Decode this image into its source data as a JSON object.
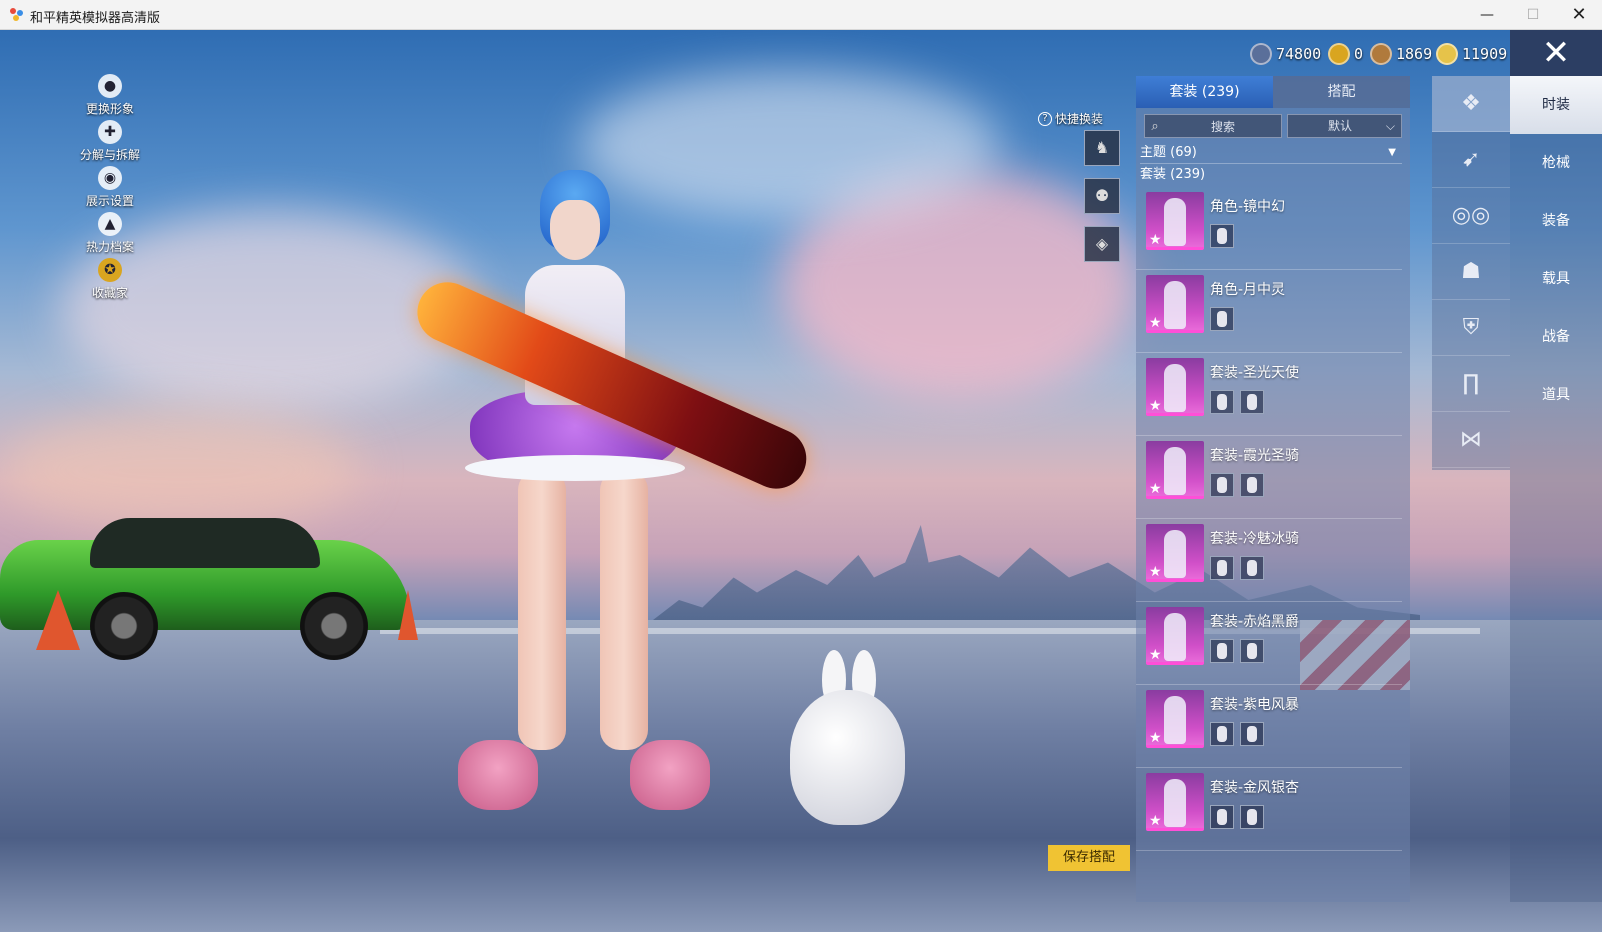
{
  "window": {
    "title": "和平精英模拟器高清版",
    "minimize": "—",
    "maximize": "☐",
    "close": "✕"
  },
  "left_menu": [
    {
      "label": "更换形象",
      "icon": "avatar-icon",
      "glyph": "●"
    },
    {
      "label": "分解与拆解",
      "icon": "puzzle-icon",
      "glyph": "✚"
    },
    {
      "label": "展示设置",
      "icon": "eye-icon",
      "glyph": "◉"
    },
    {
      "label": "热力档案",
      "icon": "flame-icon",
      "glyph": "▲"
    },
    {
      "label": "收藏家",
      "icon": "collector-badge-icon",
      "glyph": "✪"
    }
  ],
  "currency": [
    {
      "value": "74800",
      "color": "#5a6f9a",
      "icon": "silver-coin-icon"
    },
    {
      "value": "0",
      "color": "#d9a520",
      "icon": "gold-a-coin-icon"
    },
    {
      "value": "1869",
      "color": "#b07a3c",
      "icon": "bronze-coin-icon"
    },
    {
      "value": "11909",
      "color": "#e6c34a",
      "icon": "gold-coin-icon"
    }
  ],
  "close_button": "✕",
  "quick_switch": {
    "label": "快捷换装",
    "help": "?",
    "slots": [
      "♞",
      "⚉",
      "◈"
    ]
  },
  "save_button": "保存搭配",
  "panel": {
    "tabs": [
      "套装 (239)",
      "搭配"
    ],
    "search_placeholder": "搜索",
    "sort_label": "默认",
    "sort_chevron": "⌵",
    "search_glyph": "⌕",
    "theme_label": "主题 (69)",
    "theme_arrow": "▼",
    "set_count": "套装 (239)",
    "items": [
      {
        "name": "角色-镜中幻",
        "subs": 1
      },
      {
        "name": "角色-月中灵",
        "subs": 1
      },
      {
        "name": "套装-圣光天使",
        "subs": 2
      },
      {
        "name": "套装-霞光圣骑",
        "subs": 2
      },
      {
        "name": "套装-冷魅冰骑",
        "subs": 2
      },
      {
        "name": "套装-赤焰黑爵",
        "subs": 2
      },
      {
        "name": "套装-紫电风暴",
        "subs": 2
      },
      {
        "name": "套装-金风银杏",
        "subs": 2
      }
    ]
  },
  "categories": [
    {
      "icon": "outfit-icon",
      "glyph": "❖"
    },
    {
      "icon": "gun-skin-icon",
      "glyph": "➹"
    },
    {
      "icon": "glasses-icon",
      "glyph": "◎◎"
    },
    {
      "icon": "mask-icon",
      "glyph": "☗"
    },
    {
      "icon": "top-icon",
      "glyph": "⛨"
    },
    {
      "icon": "pants-icon",
      "glyph": "∏"
    },
    {
      "icon": "shoes-icon",
      "glyph": "⋈"
    }
  ],
  "nav": [
    "时装",
    "枪械",
    "装备",
    "载具",
    "战备",
    "道具"
  ]
}
